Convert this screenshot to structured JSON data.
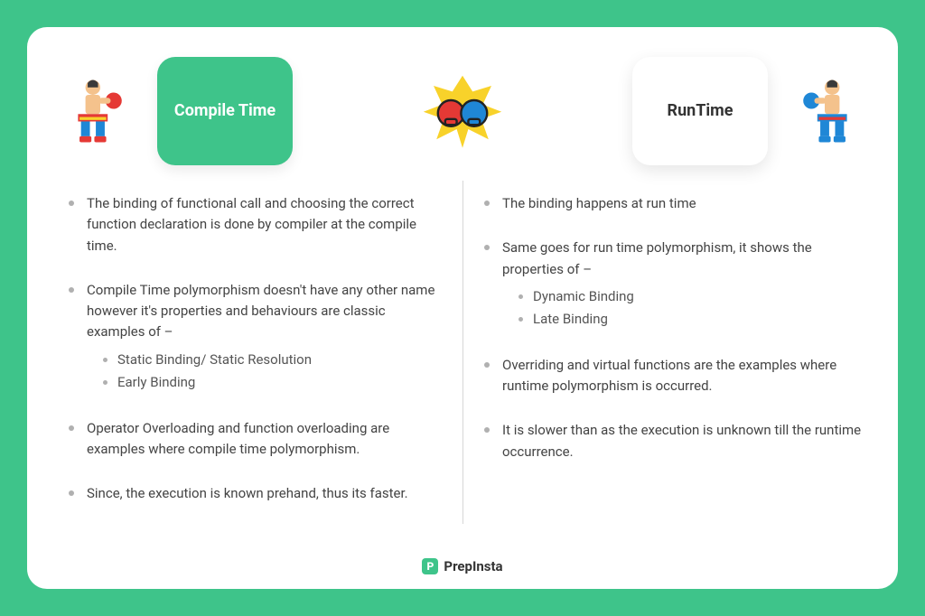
{
  "brand": {
    "name": "PrepInsta"
  },
  "colors": {
    "accent": "#3ec48a",
    "red": "#e53935",
    "blue": "#1f87d6",
    "yellow": "#f8d22a"
  },
  "left": {
    "badge_label": "Compile Time",
    "points": [
      {
        "text": "The binding of functional call and choosing the correct function declaration is done by compiler at the compile time."
      },
      {
        "text": "Compile Time polymorphism doesn't have any other name however it's properties and behaviours are classic examples of –",
        "sub": [
          "Static Binding/ Static Resolution",
          "Early Binding"
        ]
      },
      {
        "text": "Operator Overloading and function overloading are examples where compile time polymorphism."
      },
      {
        "text": "Since, the execution is known prehand, thus its faster."
      }
    ]
  },
  "right": {
    "badge_label": "RunTime",
    "points": [
      {
        "text": "The binding happens at run time"
      },
      {
        "text": "Same goes for run time polymorphism, it shows the properties of –",
        "sub": [
          "Dynamic Binding",
          "Late Binding"
        ]
      },
      {
        "text": "Overriding and virtual functions are the examples where runtime polymorphism is occurred."
      },
      {
        "text": "It is slower than as the execution is unknown till the runtime occurrence."
      }
    ]
  }
}
